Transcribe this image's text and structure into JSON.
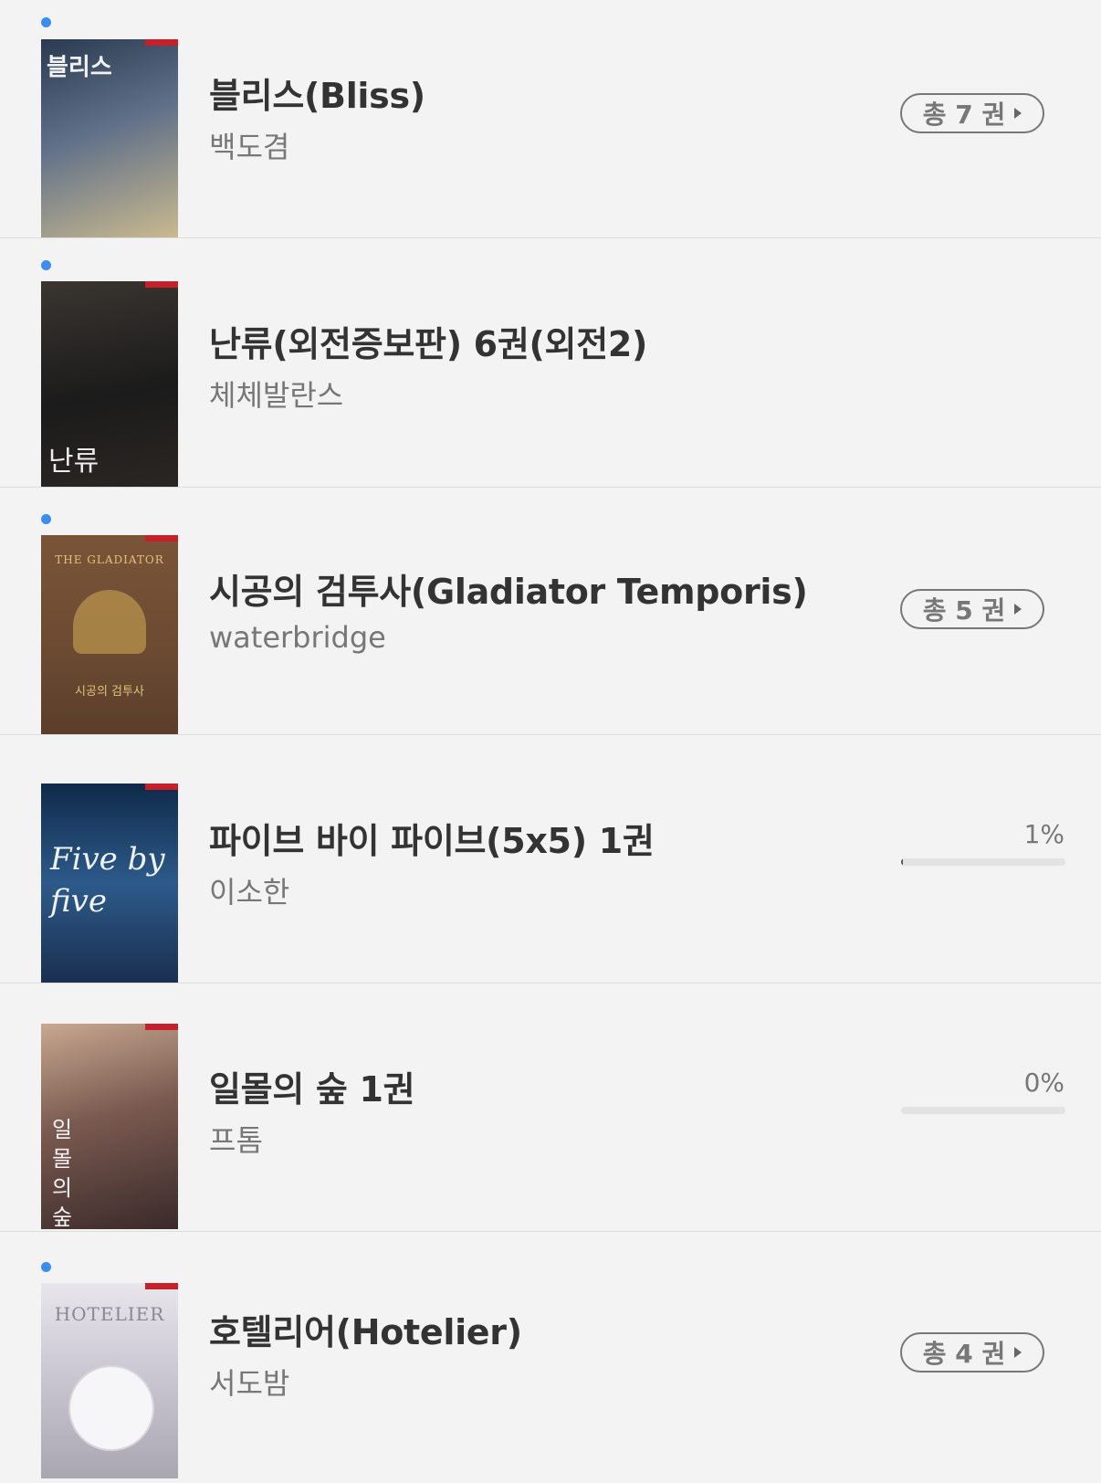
{
  "books": [
    {
      "has_new": true,
      "title": "블리스(Bliss)",
      "author": "백도겸",
      "count_label": "총 7 권",
      "cover_text": "블리스",
      "cover_colors": [
        "#2a3a50",
        "#607089",
        "#c9b98f"
      ]
    },
    {
      "has_new": true,
      "title": "난류(외전증보판) 6권(외전2)",
      "author": "체체발란스",
      "cover_text": "난류",
      "cover_colors": [
        "#1b1b1b",
        "#3a3530",
        "#6f6356"
      ]
    },
    {
      "has_new": true,
      "title": "시공의 검투사(Gladiator Temporis)",
      "author": "waterbridge",
      "count_label": "총 5 권",
      "cover_text": "THE GLADIATOR",
      "cover_subtext": "시공의 검투사",
      "cover_colors": [
        "#6b4a32",
        "#8a6140",
        "#b08b4a"
      ]
    },
    {
      "has_new": false,
      "title": "파이브 바이 파이브(5x5) 1권",
      "author": "이소한",
      "progress_label": "1%",
      "progress": 0.01,
      "cover_text": "Five by five",
      "cover_colors": [
        "#0f2a4a",
        "#2d5a8a",
        "#5f8fb8"
      ]
    },
    {
      "has_new": false,
      "title": "일몰의 숲 1권",
      "author": "프톰",
      "progress_label": "0%",
      "progress": 0.0,
      "cover_text": "일몰의 숲",
      "cover_colors": [
        "#3a2a2a",
        "#7a5a50",
        "#c8a890"
      ]
    },
    {
      "has_new": true,
      "title": "호텔리어(Hotelier)",
      "author": "서도밤",
      "count_label": "총 4 권",
      "cover_text": "HOTELIER",
      "cover_colors": [
        "#cfcbd6",
        "#a9a6b2",
        "#e8e6ec"
      ]
    }
  ],
  "colors": {
    "new_dot": "#3b8ef0",
    "background": "#f3f3f3"
  }
}
